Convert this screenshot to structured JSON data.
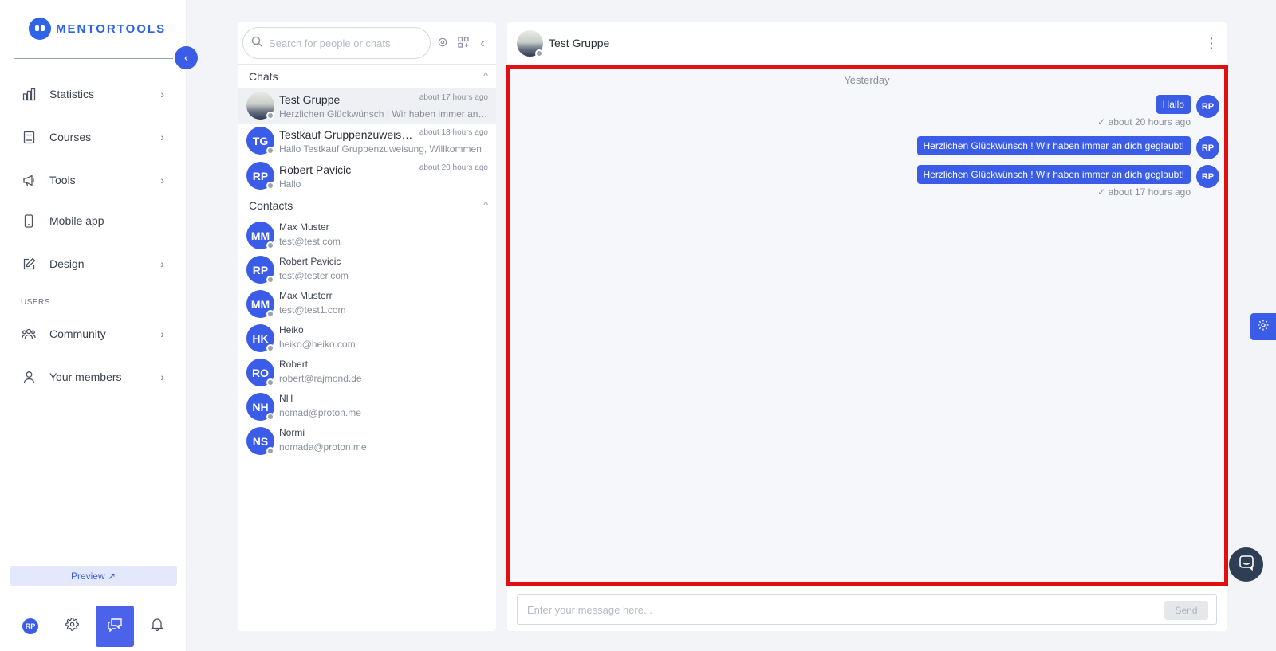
{
  "brand": {
    "name": "MENTORTOOLS"
  },
  "sidebar": {
    "items": [
      {
        "label": "Statistics",
        "icon": "bar-chart-icon"
      },
      {
        "label": "Courses",
        "icon": "book-icon"
      },
      {
        "label": "Tools",
        "icon": "megaphone-icon"
      },
      {
        "label": "Mobile app",
        "icon": "phone-icon"
      },
      {
        "label": "Design",
        "icon": "edit-icon"
      }
    ],
    "users_section": "USERS",
    "user_items": [
      {
        "label": "Community",
        "icon": "community-icon"
      },
      {
        "label": "Your members",
        "icon": "user-icon"
      }
    ],
    "preview_label": "Preview ↗",
    "avatar_initials": "RP"
  },
  "chat_list": {
    "search_placeholder": "Search for people or chats",
    "chats_heading": "Chats",
    "contacts_heading": "Contacts",
    "chats": [
      {
        "name": "Test Gruppe",
        "time": "about 17 hours ago",
        "preview": "Herzlichen Glückwünsch ! Wir haben immer an dich geglaubt!",
        "initials": ""
      },
      {
        "name": "Testkauf Gruppenzuweisung",
        "time": "about 18 hours ago",
        "preview": "Hallo Testkauf Gruppenzuweisung, Willkommen",
        "initials": "TG"
      },
      {
        "name": "Robert Pavicic",
        "time": "about 20 hours ago",
        "preview": "Hallo",
        "initials": "RP"
      }
    ],
    "contacts": [
      {
        "name": "Max Muster",
        "email": "test@test.com",
        "initials": "MM"
      },
      {
        "name": "Robert Pavicic",
        "email": "test@tester.com",
        "initials": "RP"
      },
      {
        "name": "Max Musterr",
        "email": "test@test1.com",
        "initials": "MM"
      },
      {
        "name": "Heiko",
        "email": "heiko@heiko.com",
        "initials": "HK"
      },
      {
        "name": "Robert",
        "email": "robert@rajmond.de",
        "initials": "RO"
      },
      {
        "name": "NH",
        "email": "nomad@proton.me",
        "initials": "NH"
      },
      {
        "name": "Normi",
        "email": "nomada@proton.me",
        "initials": "NS"
      }
    ]
  },
  "conversation": {
    "title": "Test Gruppe",
    "day_label": "Yesterday",
    "messages": [
      {
        "text": "Hallo",
        "sender": "RP",
        "meta": "about 20 hours ago"
      },
      {
        "text": "Herzlichen Glückwünsch ! Wir haben immer an dich geglaubt!",
        "sender": "RP",
        "meta": ""
      },
      {
        "text": "Herzlichen Glückwünsch ! Wir haben immer an dich geglaubt!",
        "sender": "RP",
        "meta": "about 17 hours ago"
      }
    ],
    "input_placeholder": "Enter your message here...",
    "send_label": "Send"
  },
  "colors": {
    "accent": "#3b5ce6",
    "highlight_border": "#e01010"
  }
}
